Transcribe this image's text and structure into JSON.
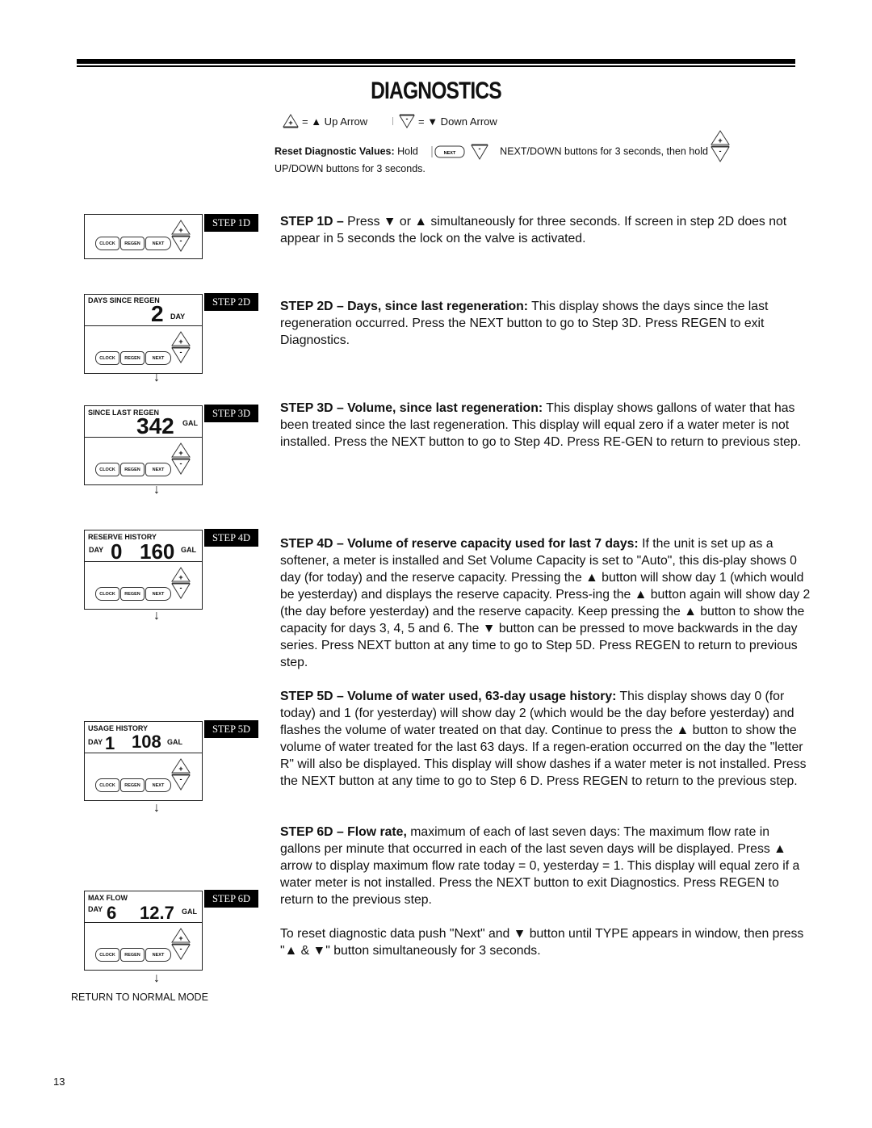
{
  "page": {
    "title": "DIAGNOSTICS",
    "page_number": "13"
  },
  "legend": {
    "up_symbol": "+",
    "up_text": "= ▲ Up Arrow",
    "down_symbol": "-",
    "down_text": "= ▼ Down Arrow"
  },
  "reset_instructions": {
    "label": "Reset Diagnostic Values:",
    "hold": "Hold",
    "next_button": "NEXT",
    "middle": "NEXT/DOWN buttons for 3 seconds, then hold",
    "end": "UP/DOWN buttons for 3 seconds."
  },
  "panel_buttons": {
    "clock": "CLOCK",
    "regen": "REGEN",
    "next": "NEXT",
    "plus": "+",
    "minus": "-"
  },
  "panels": [
    {
      "step": "STEP 1D",
      "caption": "",
      "day_label": "",
      "day_value": "",
      "value": "",
      "unit": ""
    },
    {
      "step": "STEP 2D",
      "caption": "DAYS SINCE REGEN",
      "day_label": "",
      "day_value": "",
      "value": "2",
      "unit": "DAY"
    },
    {
      "step": "STEP 3D",
      "caption": "SINCE LAST REGEN",
      "day_label": "",
      "day_value": "",
      "value": "342",
      "unit": "GAL"
    },
    {
      "step": "STEP 4D",
      "caption": "RESERVE HISTORY",
      "day_label": "DAY",
      "day_value": "0",
      "value": "160",
      "unit": "GAL"
    },
    {
      "step": "STEP 5D",
      "caption": "USAGE HISTORY",
      "day_label": "DAY",
      "day_value": "1",
      "value": "108",
      "unit": "GAL"
    },
    {
      "step": "STEP 6D",
      "caption": "MAX FLOW",
      "day_label": "DAY",
      "day_value": "6",
      "value": "12.7",
      "unit": "GAL"
    }
  ],
  "flow_arrow": "↓",
  "return_label": "RETURN TO NORMAL MODE",
  "steps": [
    {
      "heading": "STEP 1D –",
      "body_html": "Press ▼ or ▲ simultaneously for three seconds.  If screen in step 2D does not appear in 5 seconds the lock on the valve is activated."
    },
    {
      "heading": "STEP 2D – Days, since last regeneration:",
      "body_html": "This display shows the days since the last regeneration occurred.  Press the NEXT button to go to Step 3D.  Press REGEN to exit Diagnostics."
    },
    {
      "heading": "STEP 3D – Volume, since last regeneration:",
      "body_html": "This display shows gallons of water that has been treated since the last regeneration.  This display will equal zero if a water meter is not installed.  Press the NEXT button to go to Step 4D.  Press RE-GEN to return to previous step."
    },
    {
      "heading": "STEP 4D – Volume of reserve capacity used for last 7 days:",
      "body_html": "If the unit is set up as a softener, a meter is installed and Set Volume Capacity is set to \"Auto\", this dis-play shows 0 day (for today) and the reserve capacity.  Pressing  the ▲ button will show day 1 (which would be yesterday) and displays the reserve capacity.  Press-ing  the ▲ button again will show day 2 (the day before yesterday) and the reserve capacity.  Keep pressing  the ▲ button to show the capacity for days 3, 4, 5 and 6.  The ▼ button can be pressed to move backwards in the day series.  Press NEXT button at any time to go to Step 5D.  Press REGEN to return to previous step."
    },
    {
      "heading": "STEP 5D – Volume of water used, 63-day usage history:",
      "body_html": "This display shows day 0 (for today) and 1 (for yesterday) will show day 2 (which would be the day before yesterday) and flashes the volume of water treated on that day.  Continue to press the  ▲ button to show the volume of water treated for the last 63 days.  If a regen-eration occurred on the day the \"letter R\" will also be displayed.  This display will show dashes if a water meter is not installed.  Press the NEXT button at any time to go to Step 6 D.  Press REGEN to return to the previous step."
    },
    {
      "heading": "STEP 6D – Flow rate,",
      "body_html": "maximum of each of last seven days: The maximum flow rate in gallons per minute that occurred in each of the last seven days will be displayed.  Press ▲ arrow to display maximum flow rate today = 0, yesterday = 1.  This display will equal zero if a water meter is not installed.  Press the NEXT button to exit Diagnostics.  Press REGEN to return to the previous step."
    }
  ],
  "reset_note": "To reset diagnostic data push \"Next\" and ▼ button until TYPE appears in window, then press \"▲ & ▼\" button simultaneously for 3 seconds."
}
